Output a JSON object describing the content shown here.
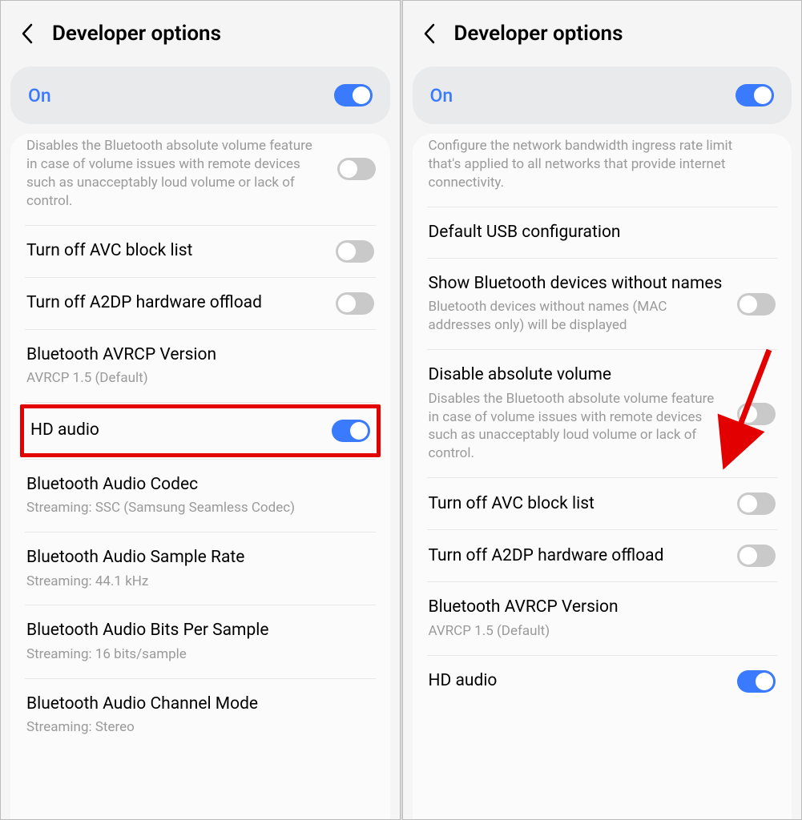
{
  "left": {
    "title": "Developer options",
    "on_label": "On",
    "partial_desc": "Disables the Bluetooth absolute volume feature in case of volume issues with remote devices such as unacceptably loud volume or lack of control.",
    "items": {
      "avc": {
        "label": "Turn off AVC block list"
      },
      "a2dp": {
        "label": "Turn off A2DP hardware offload"
      },
      "avrcp": {
        "label": "Bluetooth AVRCP Version",
        "desc": "AVRCP 1.5 (Default)"
      },
      "hd": {
        "label": "HD audio"
      },
      "codec": {
        "label": "Bluetooth Audio Codec",
        "desc": "Streaming: SSC (Samsung Seamless Codec)"
      },
      "sample": {
        "label": "Bluetooth Audio Sample Rate",
        "desc": "Streaming: 44.1 kHz"
      },
      "bits": {
        "label": "Bluetooth Audio Bits Per Sample",
        "desc": "Streaming: 16 bits/sample"
      },
      "channel": {
        "label": "Bluetooth Audio Channel Mode",
        "desc": "Streaming: Stereo"
      }
    }
  },
  "right": {
    "title": "Developer options",
    "on_label": "On",
    "partial_desc": "Configure the network bandwidth ingress rate limit that's applied to all networks that provide internet connectivity.",
    "items": {
      "usb": {
        "label": "Default USB configuration"
      },
      "btnames": {
        "label": "Show Bluetooth devices without names",
        "desc": "Bluetooth devices without names (MAC addresses only) will be displayed"
      },
      "absvol": {
        "label": "Disable absolute volume",
        "desc": "Disables the Bluetooth absolute volume feature in case of volume issues with remote devices such as unacceptably loud volume or lack of control."
      },
      "avc": {
        "label": "Turn off AVC block list"
      },
      "a2dp": {
        "label": "Turn off A2DP hardware offload"
      },
      "avrcp": {
        "label": "Bluetooth AVRCP Version",
        "desc": "AVRCP 1.5 (Default)"
      },
      "hd": {
        "label": "HD audio"
      }
    }
  }
}
